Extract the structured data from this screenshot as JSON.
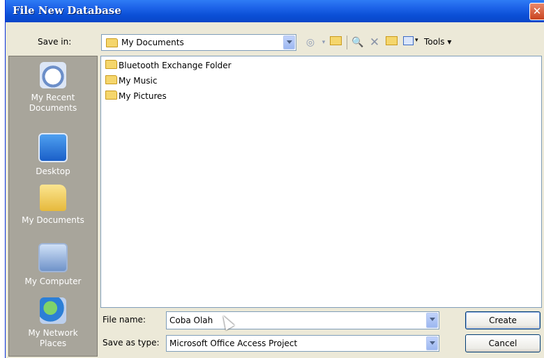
{
  "window": {
    "title": "File New Database",
    "close_glyph": "✕"
  },
  "save_in": {
    "label": "Save in:",
    "value": "My Documents"
  },
  "toolbar": {
    "tools_label": "Tools ▾"
  },
  "places": [
    {
      "label": "My Recent Documents"
    },
    {
      "label": "Desktop"
    },
    {
      "label": "My Documents"
    },
    {
      "label": "My Computer"
    },
    {
      "label": "My Network Places"
    }
  ],
  "files": [
    {
      "name": "Bluetooth Exchange Folder"
    },
    {
      "name": "My Music"
    },
    {
      "name": "My Pictures"
    }
  ],
  "file_name": {
    "label": "File name:",
    "value": "Coba Olah"
  },
  "save_as_type": {
    "label": "Save as type:",
    "value": "Microsoft Office Access Project"
  },
  "buttons": {
    "create": "Create",
    "cancel": "Cancel"
  }
}
